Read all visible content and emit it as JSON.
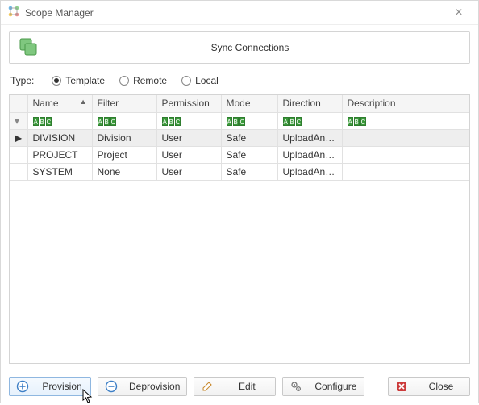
{
  "window": {
    "title": "Scope Manager"
  },
  "banner": {
    "label": "Sync Connections"
  },
  "type_row": {
    "label": "Type:",
    "options": {
      "template": "Template",
      "remote": "Remote",
      "local": "Local"
    },
    "selected": "template"
  },
  "grid": {
    "headers": {
      "name": "Name",
      "filter": "Filter",
      "permission": "Permission",
      "mode": "Mode",
      "direction": "Direction",
      "description": "Description"
    },
    "sort_column": "name",
    "sort_dir": "asc",
    "rows": [
      {
        "name": "DIVISION",
        "filter": "Division",
        "permission": "User",
        "mode": "Safe",
        "direction": "UploadAnd...",
        "description": "",
        "selected": true
      },
      {
        "name": "PROJECT",
        "filter": "Project",
        "permission": "User",
        "mode": "Safe",
        "direction": "UploadAnd...",
        "description": "",
        "selected": false
      },
      {
        "name": "SYSTEM",
        "filter": "None",
        "permission": "User",
        "mode": "Safe",
        "direction": "UploadAnd...",
        "description": "",
        "selected": false
      }
    ]
  },
  "buttons": {
    "provision": "Provision",
    "deprovision": "Deprovision",
    "edit": "Edit",
    "configure": "Configure",
    "close": "Close"
  }
}
